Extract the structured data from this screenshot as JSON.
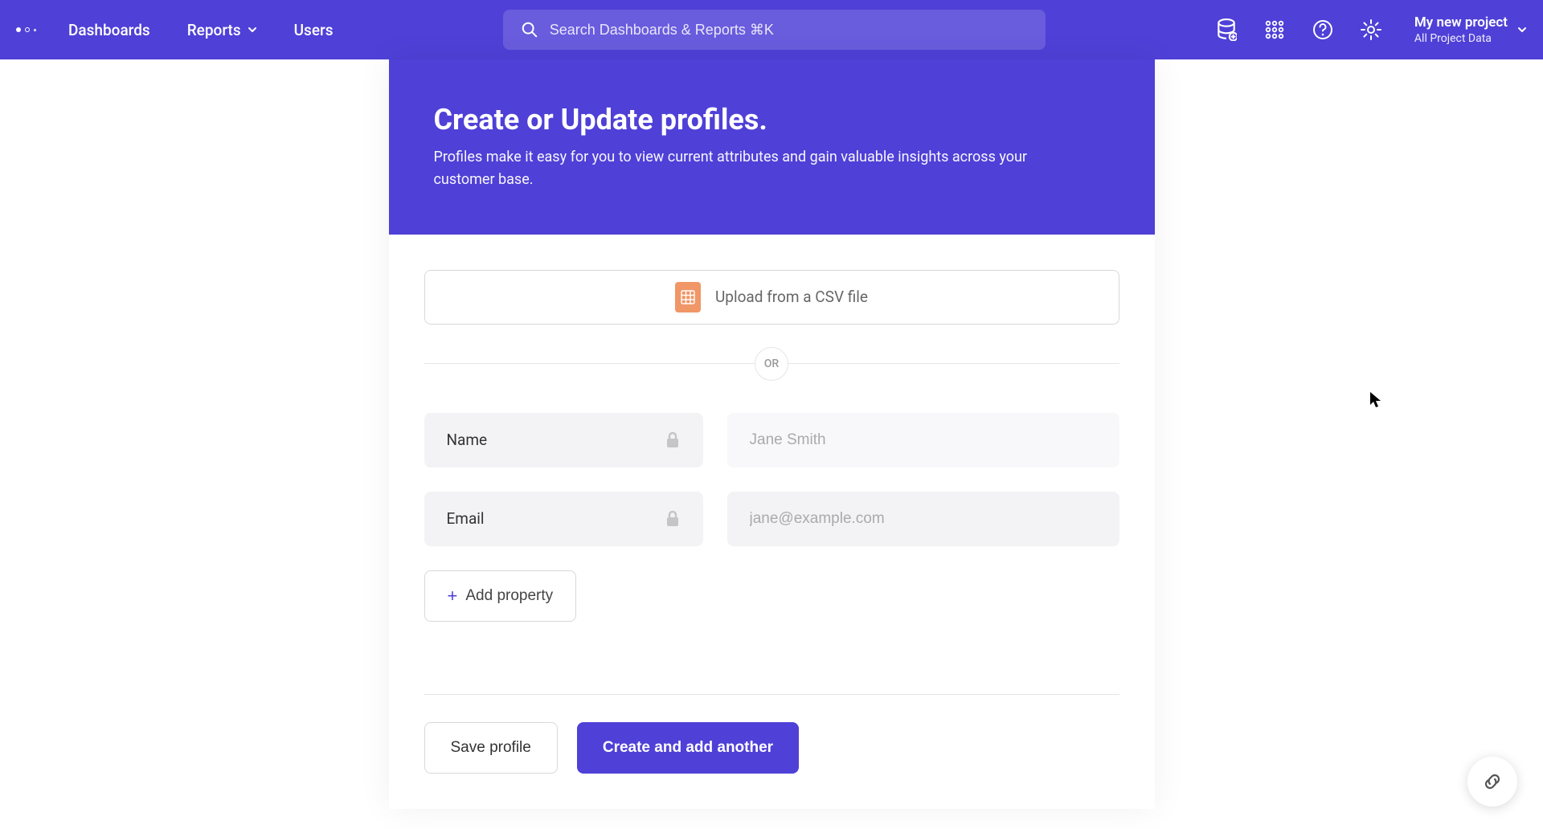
{
  "nav": {
    "dashboards": "Dashboards",
    "reports": "Reports",
    "users": "Users"
  },
  "search": {
    "placeholder": "Search Dashboards & Reports ⌘K"
  },
  "project": {
    "name": "My new project",
    "subtitle": "All Project Data"
  },
  "hero": {
    "title": "Create or Update profiles.",
    "description": "Profiles make it easy for you to view current attributes and gain valuable insights across your customer base."
  },
  "upload": {
    "label": "Upload from a CSV file"
  },
  "divider": {
    "label": "OR"
  },
  "fields": {
    "name": {
      "label": "Name",
      "placeholder": "Jane Smith",
      "value": ""
    },
    "email": {
      "label": "Email",
      "placeholder": "jane@example.com",
      "value": ""
    }
  },
  "addProperty": {
    "label": "Add property"
  },
  "actions": {
    "save": "Save profile",
    "createAnother": "Create and add another"
  }
}
